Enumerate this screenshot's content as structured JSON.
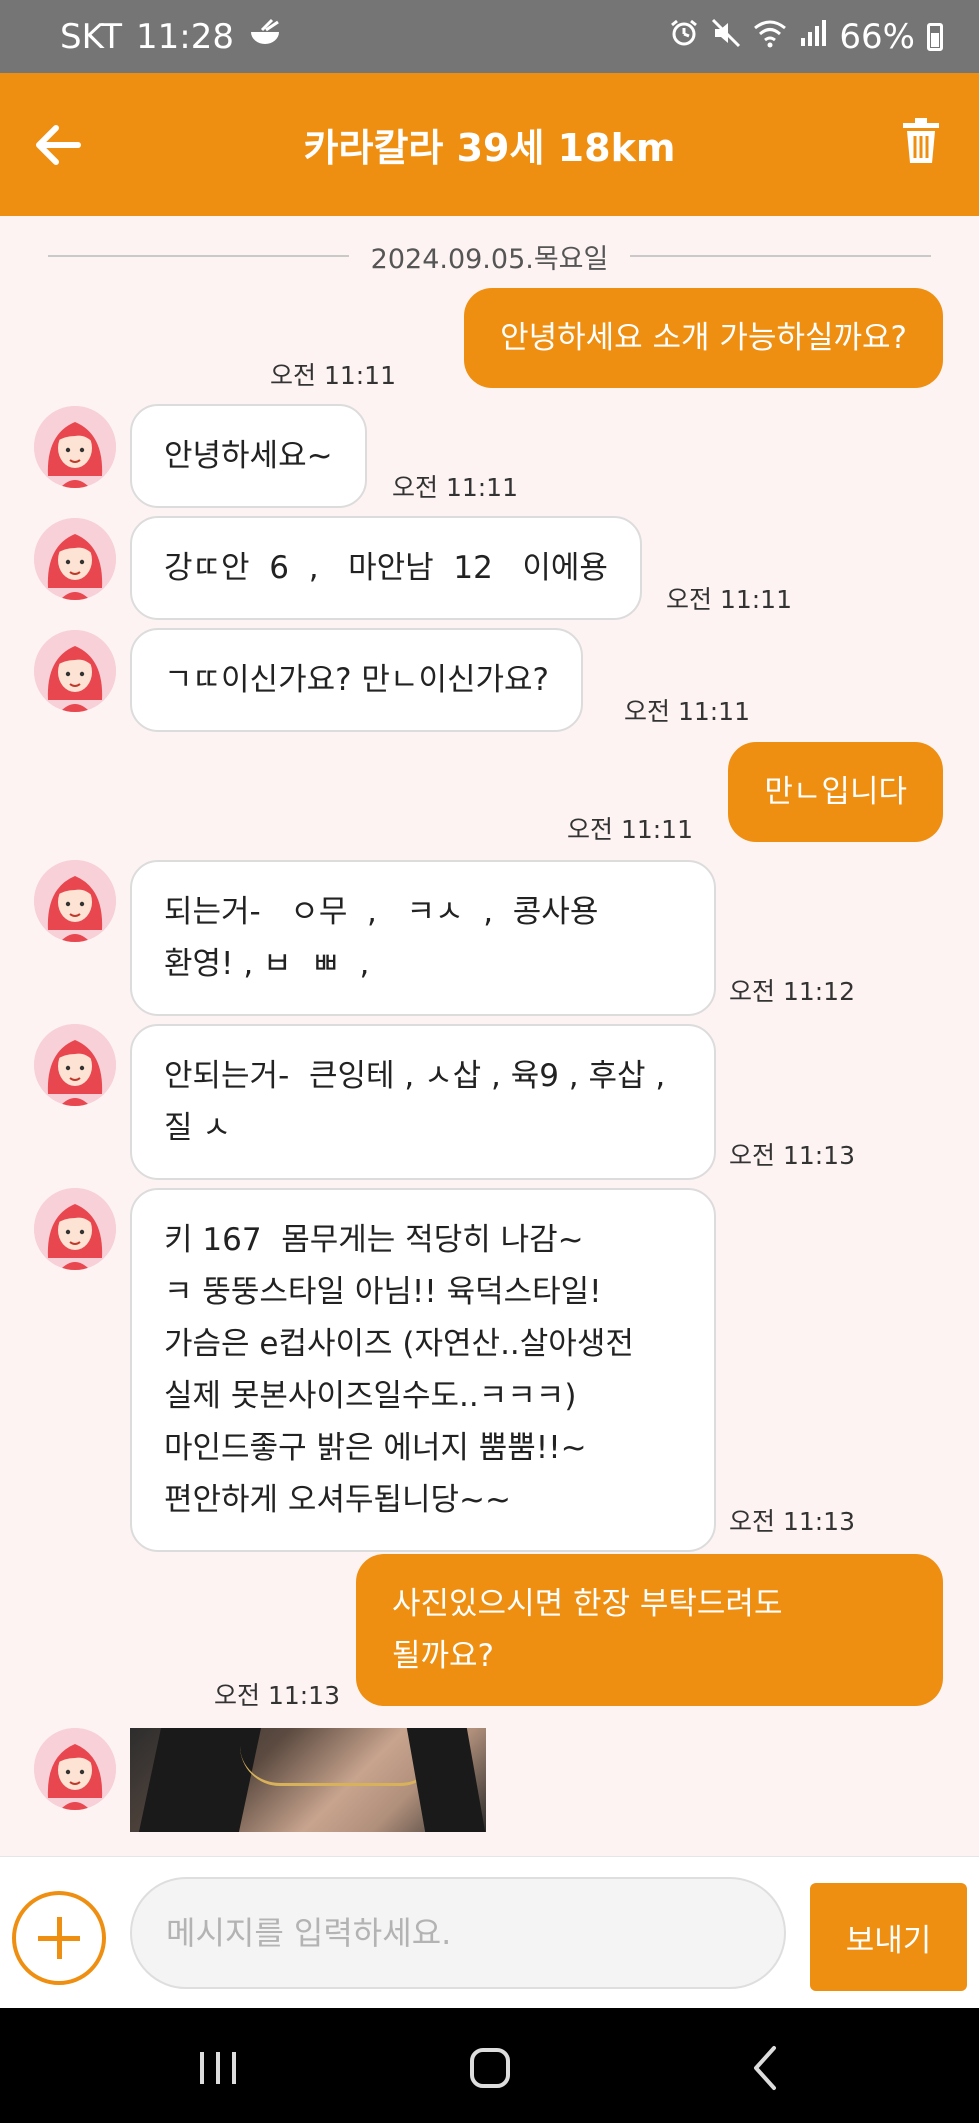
{
  "status_bar": {
    "carrier": "SKT",
    "time": "11:28",
    "battery": "66%"
  },
  "header": {
    "title": "카라칼라 39세 18km"
  },
  "chat": {
    "date": "2024.09.05.목요일",
    "messages": [
      {
        "side": "out",
        "text": "안녕하세요 소개 가능하실까요?",
        "time": "오전 11:11"
      },
      {
        "side": "in",
        "text": "안녕하세요~",
        "time": "오전 11:11"
      },
      {
        "side": "in",
        "text": "강ㄸ안  6  ,   마안남  12   이에용",
        "time": "오전 11:11"
      },
      {
        "side": "in",
        "text": "ㄱㄸ이신가요? 만ㄴ이신가요?",
        "time": "오전 11:11"
      },
      {
        "side": "out",
        "text": "만ㄴ입니다",
        "time": "오전 11:11"
      },
      {
        "side": "in",
        "text": "되는거-   ㅇ무  ,   ㅋㅅ  ,  콩사용\n환영! , ㅂ  ㅃ  ,",
        "time": "오전 11:12"
      },
      {
        "side": "in",
        "text": "안되는거-  큰잉테 , ㅅ삽 , 육9 , 후삽 ,\n질 ㅅ",
        "time": "오전 11:13"
      },
      {
        "side": "in",
        "text": "키 167  몸무게는 적당히 나감~\nㅋ 뚱뚱스타일 아님!! 육덕스타일!\n가슴은 e컵사이즈 (자연산..살아생전\n실제 못본사이즈일수도..ㅋㅋㅋ)\n마인드좋구 밝은 에너지 뿜뿜!!~\n편안하게 오셔두됩니당~~",
        "time": "오전 11:13"
      },
      {
        "side": "out",
        "text": "사진있으시면 한장 부탁드려도\n될까요?",
        "time": "오전 11:13"
      }
    ]
  },
  "composer": {
    "placeholder": "메시지를 입력하세요.",
    "send_label": "보내기"
  },
  "colors": {
    "accent": "#ef8f12",
    "background": "#fdf3f3",
    "status_bar": "#757575"
  },
  "icons": {
    "back": "arrow-left-icon",
    "delete": "trash-icon",
    "attach": "plus-circle-icon"
  }
}
